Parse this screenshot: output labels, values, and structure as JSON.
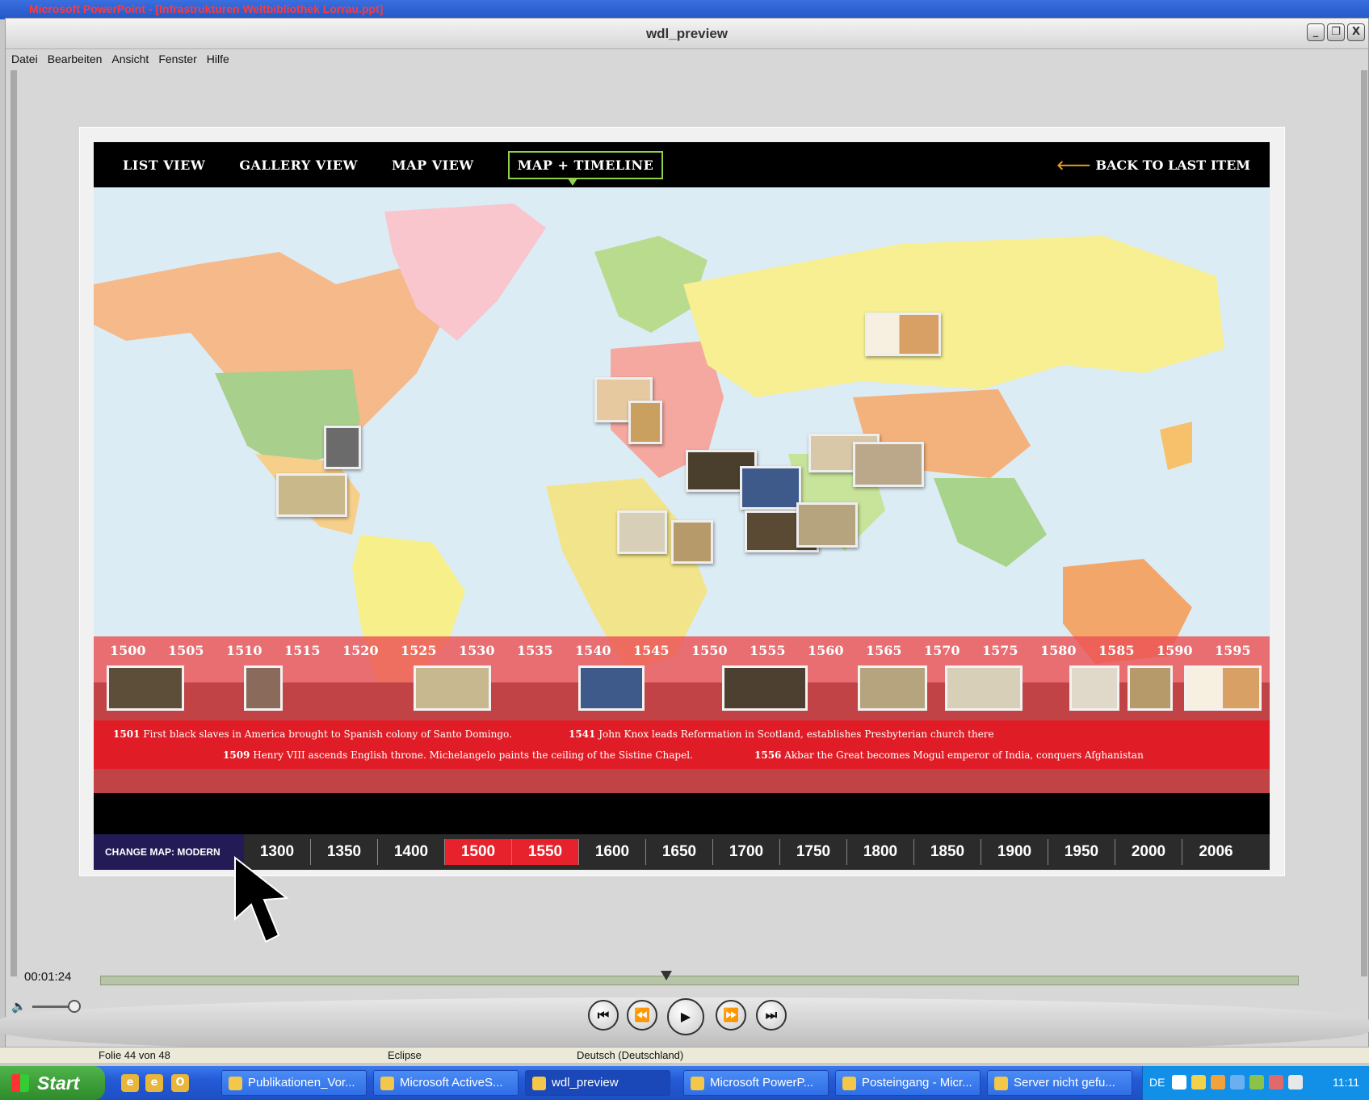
{
  "background_window": {
    "title": "Microsoft PowerPoint - [Infrastrukturen Weltbibliothek Lorrau.ppt]"
  },
  "player": {
    "title": "wdl_preview",
    "window_buttons": [
      "_",
      "❐",
      "X"
    ],
    "menu": [
      "Datei",
      "Bearbeiten",
      "Ansicht",
      "Fenster",
      "Hilfe"
    ],
    "time": "00:01:24",
    "progress_fraction": 0.51
  },
  "app": {
    "nav": [
      "LIST VIEW",
      "GALLERY VIEW",
      "MAP VIEW",
      "MAP + TIMELINE"
    ],
    "active_nav": "MAP + TIMELINE",
    "back_label": "BACK TO LAST ITEM",
    "years": [
      "1500",
      "1505",
      "1510",
      "1515",
      "1520",
      "1525",
      "1530",
      "1535",
      "1540",
      "1545",
      "1550",
      "1555",
      "1560",
      "1565",
      "1570",
      "1575",
      "1580",
      "1585",
      "1590",
      "1595"
    ],
    "events": [
      {
        "year": "1501",
        "text": "First black slaves in America brought to Spanish colony of Santo Domingo."
      },
      {
        "year": "1541",
        "text": "John Knox leads Reformation in Scotland, establishes Presbyterian church there"
      },
      {
        "year": "1509",
        "text": "Henry VIII ascends English throne. Michelangelo paints the ceiling of the Sistine Chapel."
      },
      {
        "year": "1556",
        "text": "Akbar the Great becomes Mogul emperor of India, conquers Afghanistan"
      }
    ],
    "change_map_label": "CHANGE MAP: MODERN",
    "centuries": [
      "1300",
      "1350",
      "1400",
      "1500",
      "1550",
      "1600",
      "1650",
      "1700",
      "1750",
      "1800",
      "1850",
      "1900",
      "1950",
      "2000",
      "2006"
    ],
    "selected_centuries": [
      "1500",
      "1550"
    ]
  },
  "status_bar": {
    "slide": "Folie 44 von 48",
    "design": "Eclipse",
    "language": "Deutsch (Deutschland)"
  },
  "taskbar": {
    "start_label": "Start",
    "tasks": [
      "Publikationen_Vor...",
      "Microsoft ActiveS...",
      "wdl_preview",
      "Microsoft PowerP...",
      "Posteingang - Micr...",
      "Server nicht gefu..."
    ],
    "active_task": "wdl_preview",
    "tray_lang": "DE",
    "clock": "11:11"
  },
  "colors": {
    "accent_green": "#8fd24a",
    "timeline_red": "#e01d26",
    "xp_blue": "#245ad6"
  }
}
